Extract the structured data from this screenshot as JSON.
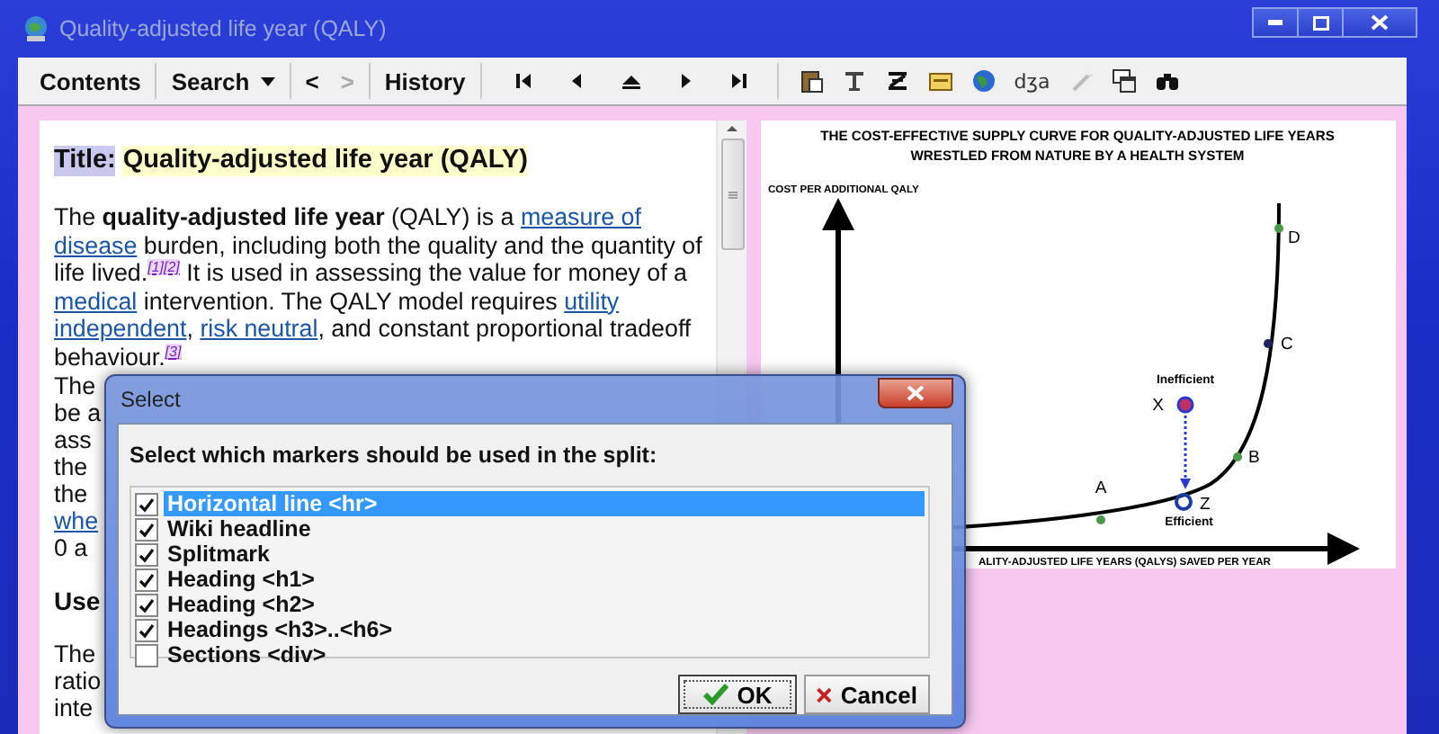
{
  "window": {
    "title": "Quality-adjusted life year (QALY)"
  },
  "toolbar": {
    "buttons": [
      {
        "kind": "text",
        "label": "Contents"
      },
      {
        "kind": "dropdown",
        "label": "Search"
      },
      {
        "kind": "arrow",
        "label": "<",
        "disabled": false
      },
      {
        "kind": "arrow",
        "label": ">",
        "disabled": true
      },
      {
        "kind": "text",
        "label": "History"
      }
    ],
    "phonetic": "dʒa"
  },
  "article": {
    "title": {
      "label": "Title:",
      "text": "Quality-adjusted life year (QALY)"
    },
    "intro": [
      {
        "kind": "text",
        "text": "The "
      },
      {
        "kind": "bold",
        "text": "quality-adjusted life year"
      },
      {
        "kind": "text",
        "text": " (QALY) is a "
      },
      {
        "kind": "link",
        "text": "measure of"
      },
      {
        "kind": "link",
        "text": "disease"
      },
      {
        "kind": "text",
        "text": " burden, including both the quality and the quantity of life lived."
      },
      {
        "kind": "ref",
        "text": "[1][2]"
      },
      {
        "kind": "text",
        "text": " It is used in assessing the value for money of a "
      },
      {
        "kind": "link",
        "text": "medical"
      },
      {
        "kind": "text",
        "text": " intervention. The QALY model requires "
      },
      {
        "kind": "link",
        "text": "utility"
      },
      {
        "kind": "link",
        "text": "independent"
      },
      {
        "kind": "text",
        "text": ", "
      },
      {
        "kind": "link",
        "text": "risk neutral"
      },
      {
        "kind": "text",
        "text": ", and constant proportional tradeoff behaviour."
      },
      {
        "kind": "ref",
        "text": "[3]"
      }
    ],
    "covered_lines": [
      {
        "kind": "text",
        "text": "The"
      },
      {
        "kind": "text",
        "text": "be a"
      },
      {
        "kind": "text",
        "text": "ass"
      },
      {
        "kind": "text",
        "text": "the"
      },
      {
        "kind": "text",
        "text": "the"
      },
      {
        "kind": "link",
        "text": "whe"
      },
      {
        "kind": "text",
        "text": "0 a"
      },
      {
        "kind": "heading",
        "text": "Use"
      },
      {
        "kind": "text",
        "text": "The"
      },
      {
        "kind": "text",
        "text": "ratio"
      },
      {
        "kind": "text",
        "text": "inte"
      }
    ]
  },
  "figure": {
    "title": [
      "THE COST-EFFECTIVE SUPPLY CURVE FOR QUALITY-ADJUSTED LIFE YEARS",
      "WRESTLED FROM NATURE BY A HEALTH SYSTEM"
    ],
    "ylabel": "COST PER ADDITIONAL QALY",
    "xlabel": "ALITY-ADJUSTED LIFE YEARS (QALYS) SAVED PER YEAR",
    "points": [
      {
        "label": "A",
        "kind": "curve"
      },
      {
        "label": "B",
        "kind": "curve"
      },
      {
        "label": "C",
        "kind": "curve"
      },
      {
        "label": "D",
        "kind": "curve"
      },
      {
        "label": "X",
        "kind": "inefficient",
        "caption": "Inefficient"
      },
      {
        "label": "Z",
        "kind": "efficient",
        "caption": "Efficient"
      }
    ]
  },
  "dialog": {
    "title": "Select",
    "prompt": "Select which markers should be used in the split:",
    "items": [
      {
        "label": "Horizontal line <hr>",
        "checked": true,
        "selected": true
      },
      {
        "label": "Wiki headline",
        "checked": true,
        "selected": false
      },
      {
        "label": "Splitmark",
        "checked": true,
        "selected": false
      },
      {
        "label": "Heading <h1>",
        "checked": true,
        "selected": false
      },
      {
        "label": "Heading <h2>",
        "checked": true,
        "selected": false
      },
      {
        "label": "Headings <h3>..<h6>",
        "checked": true,
        "selected": false
      },
      {
        "label": "Sections <div>",
        "checked": false,
        "selected": false
      }
    ],
    "ok": "OK",
    "cancel": "Cancel"
  }
}
